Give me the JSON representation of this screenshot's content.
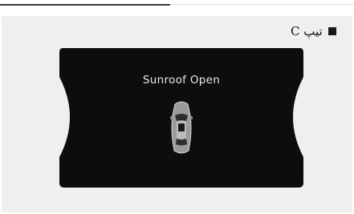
{
  "header": {
    "section_label": "تیپ C"
  },
  "cluster_display": {
    "message": "Sunroof Open",
    "icon": "car-top-view-sunroof-icon",
    "background_color": "#0d0d0d",
    "text_color": "#e8e8e8"
  }
}
